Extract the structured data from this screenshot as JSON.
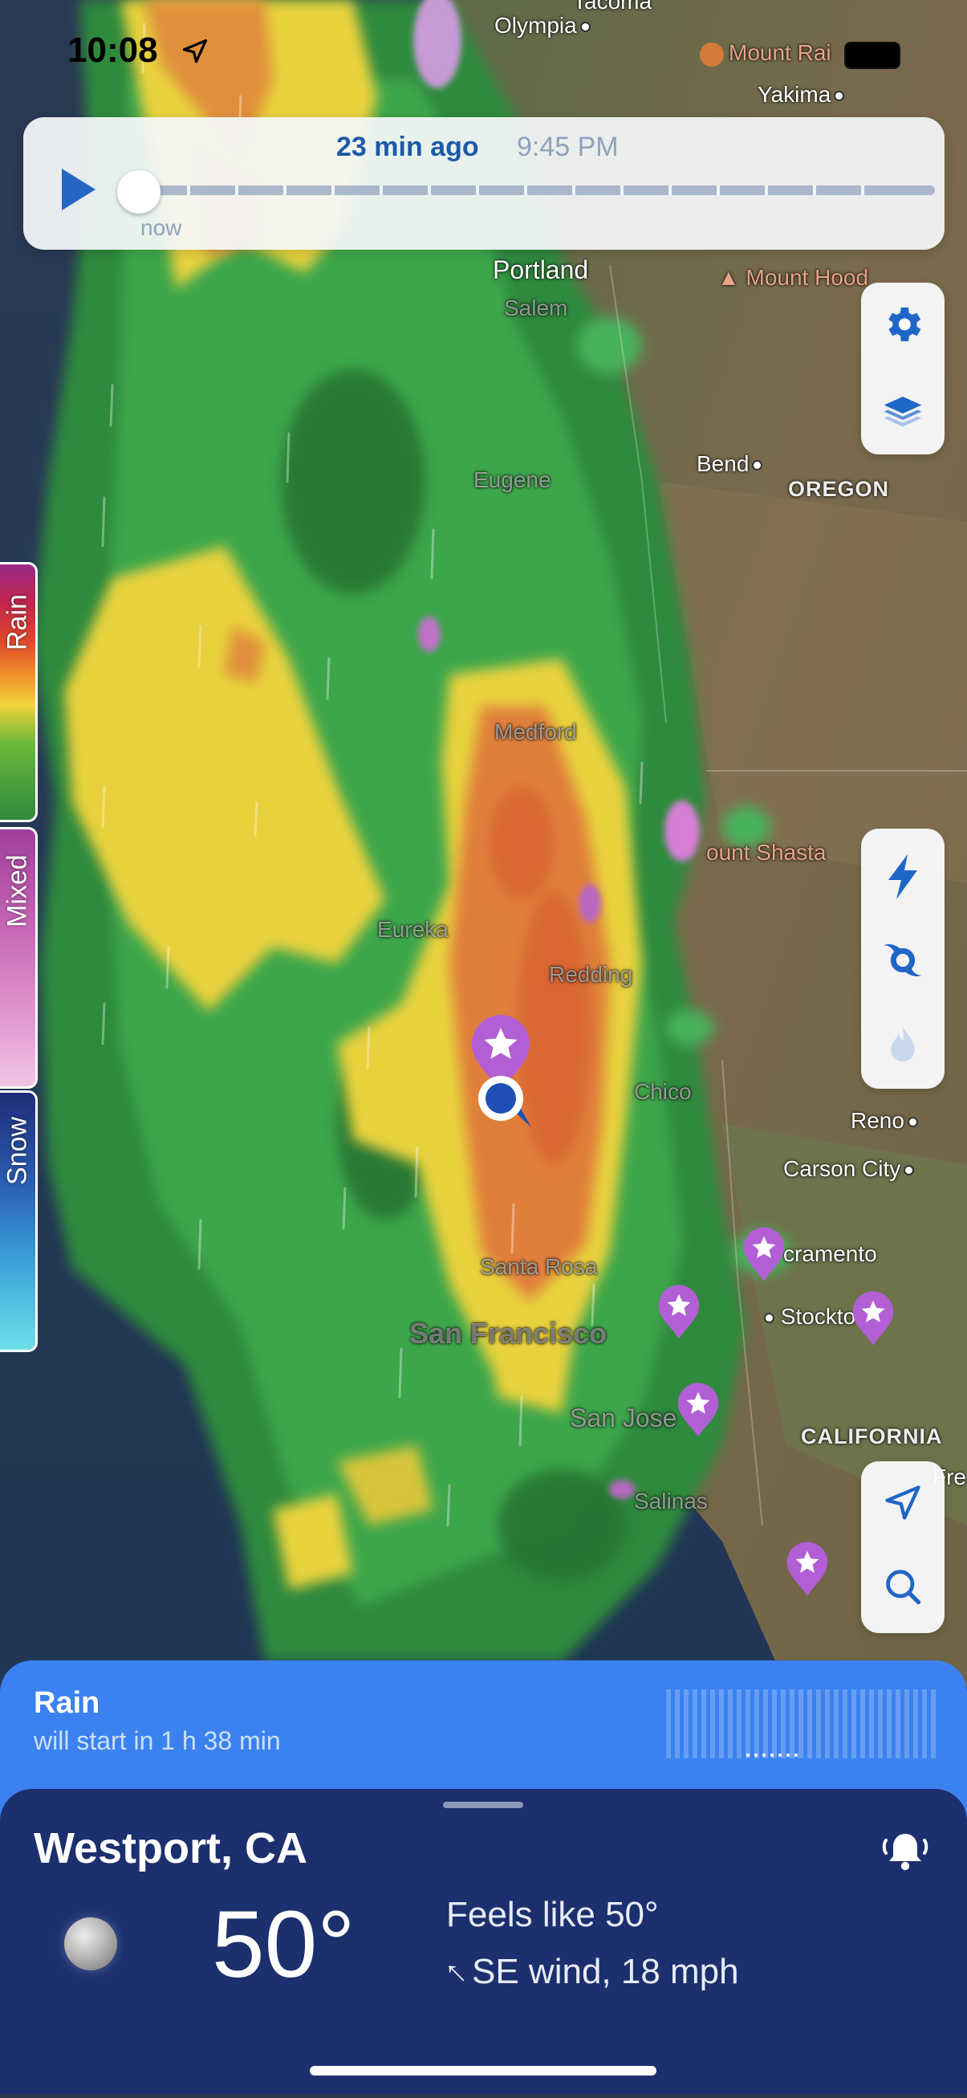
{
  "status_bar": {
    "time": "10:08"
  },
  "timeline": {
    "ago": "23 min ago",
    "time": "9:45 PM",
    "now_label": "now"
  },
  "legend": {
    "rain": "Rain",
    "mixed": "Mixed",
    "snow": "Snow"
  },
  "map_labels": {
    "tacoma": "Tacoma",
    "olympia": "Olympia",
    "mount_rainier": "Mount Rai",
    "yakima": "Yakima",
    "portland": "Portland",
    "mount_hood": "Mount Hood",
    "salem": "Salem",
    "eugene": "Eugene",
    "bend": "Bend",
    "oregon": "OREGON",
    "medford": "Medford",
    "mount_shasta": "ount Shasta",
    "eureka": "Eureka",
    "redding": "Redding",
    "chico": "Chico",
    "reno": "Reno",
    "carson_city": "Carson City",
    "sacramento": "cramento",
    "santa_rosa": "Santa Rosa",
    "stockton": "Stockto",
    "san_francisco": "San Francisco",
    "san_jose": "San Jose",
    "california": "CALIFORNIA",
    "fresno": "Fre",
    "salinas": "Salinas"
  },
  "rain_banner": {
    "title": "Rain",
    "subtitle": "will start in 1 h 38 min"
  },
  "weather": {
    "location": "Westport, CA",
    "temperature": "50°",
    "feels_like": "Feels like 50°",
    "wind": "SE wind, 18 mph"
  },
  "icons": {
    "play": "play-icon",
    "settings": "gear-icon",
    "layers": "layers-icon",
    "lightning": "lightning-icon",
    "hurricane": "hurricane-icon",
    "fire": "fire-icon",
    "locate": "location-arrow-icon",
    "search": "search-icon",
    "bell": "bell-icon",
    "moon": "moon-icon"
  },
  "colors": {
    "accent": "#3b82f0",
    "sheet_bg": "#1c2f6e",
    "timeline_text": "#1e5aa6",
    "favorite_pin": "#b25fd6",
    "icon_blue": "#1f66c9"
  }
}
